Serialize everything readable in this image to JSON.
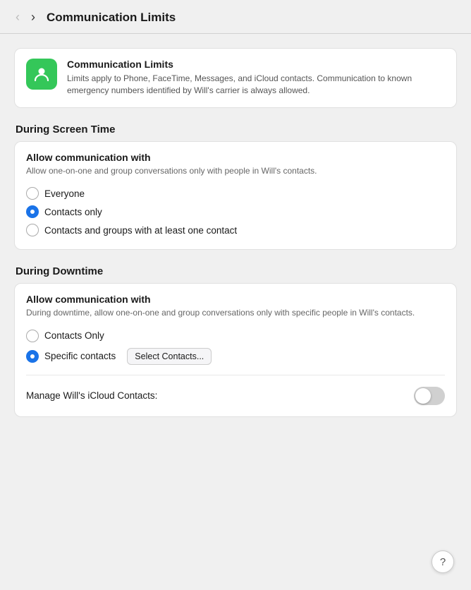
{
  "topbar": {
    "title": "Communication Limits",
    "back_label": "‹",
    "forward_label": "›"
  },
  "info_card": {
    "title": "Communication Limits",
    "description": "Limits apply to Phone, FaceTime, Messages, and iCloud contacts. Communication to known emergency numbers identified by Will's carrier is always allowed."
  },
  "screen_time_section": {
    "header": "During Screen Time",
    "card_title": "Allow communication with",
    "card_desc": "Allow one-on-one and group conversations only with people in Will's contacts.",
    "options": [
      {
        "id": "everyone",
        "label": "Everyone",
        "selected": false
      },
      {
        "id": "contacts_only",
        "label": "Contacts only",
        "selected": true
      },
      {
        "id": "contacts_groups",
        "label": "Contacts and groups with at least one contact",
        "selected": false
      }
    ]
  },
  "downtime_section": {
    "header": "During Downtime",
    "card_title": "Allow communication with",
    "card_desc": "During downtime, allow one-on-one and group conversations only with specific people in Will's contacts.",
    "options": [
      {
        "id": "contacts_only_dt",
        "label": "Contacts Only",
        "selected": false
      },
      {
        "id": "specific_contacts",
        "label": "Specific contacts",
        "selected": true
      }
    ],
    "select_button_label": "Select Contacts...",
    "manage_label": "Manage Will's iCloud Contacts:",
    "toggle_on": false
  },
  "help_button_label": "?"
}
